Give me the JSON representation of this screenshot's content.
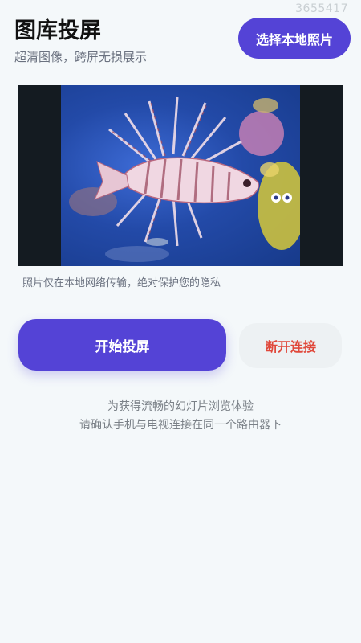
{
  "watermark": "3655417",
  "header": {
    "title": "图库投屏",
    "subtitle": "超清图像，跨屏无损展示",
    "pick_button": "选择本地照片"
  },
  "preview": {
    "privacy_note": "照片仅在本地网络传输，绝对保护您的隐私"
  },
  "actions": {
    "start_label": "开始投屏",
    "disconnect_label": "断开连接"
  },
  "tips": {
    "line1": "为获得流畅的幻灯片浏览体验",
    "line2": "请确认手机与电视连接在同一个路由器下"
  },
  "colors": {
    "accent": "#5443d6",
    "danger": "#e0483b",
    "background": "#f4f8fa"
  }
}
